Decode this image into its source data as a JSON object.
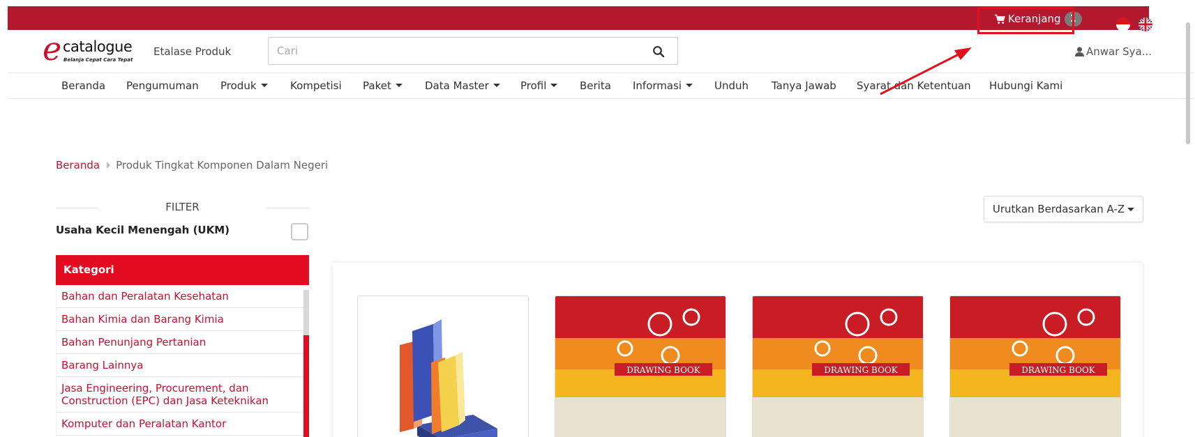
{
  "topbar": {
    "cart_label": "Keranjang",
    "cart_count": "1",
    "cart_icon": "shopping-cart-icon",
    "languages": [
      "id-flag",
      "en-flag"
    ]
  },
  "header": {
    "logo_letter": "e",
    "logo_word": "catalogue",
    "logo_tagline": "Belanja Cepat Cara Tepat",
    "etalase_label": "Etalase Produk",
    "search_placeholder": "Cari",
    "search_icon": "search-icon",
    "user_name": "Anwar Sya...",
    "user_icon": "user-icon"
  },
  "nav": {
    "items": [
      {
        "label": "Beranda",
        "dropdown": false
      },
      {
        "label": "Pengumuman",
        "dropdown": false
      },
      {
        "label": "Produk",
        "dropdown": true
      },
      {
        "label": "Kompetisi",
        "dropdown": false
      },
      {
        "label": "Paket",
        "dropdown": true
      },
      {
        "label": "Data Master",
        "dropdown": true
      },
      {
        "label": "Profil",
        "dropdown": true
      },
      {
        "label": "Berita",
        "dropdown": false
      },
      {
        "label": "Informasi",
        "dropdown": true
      },
      {
        "label": "Unduh",
        "dropdown": false
      },
      {
        "label": "Tanya Jawab",
        "dropdown": false
      },
      {
        "label": "Syarat dan Ketentuan",
        "dropdown": false
      },
      {
        "label": "Hubungi Kami",
        "dropdown": false
      }
    ]
  },
  "breadcrumb": {
    "home": "Beranda",
    "current": "Produk Tingkat Komponen Dalam Negeri"
  },
  "filter": {
    "title": "FILTER",
    "ukm_label": "Usaha Kecil Menengah (UKM)",
    "ukm_checked": false
  },
  "kategori": {
    "title": "Kategori",
    "items": [
      "Bahan dan Peralatan Kesehatan",
      "Bahan Kimia dan Barang Kimia",
      "Bahan Penunjang Pertanian",
      "Barang Lainnya",
      "Jasa Engineering, Procurement, dan Construction (EPC) dan Jasa Keteknikan",
      "Komputer dan Peralatan Kantor"
    ]
  },
  "sort": {
    "label": "Urutkan Berdasarkan A-Z"
  },
  "products": [
    {
      "image": "books-illustration"
    },
    {
      "image": "drawing-book-photo",
      "cover_text": "DRAWING BOOK"
    },
    {
      "image": "drawing-book-photo",
      "cover_text": "DRAWING BOOK"
    },
    {
      "image": "drawing-book-photo",
      "cover_text": "DRAWING BOOK"
    }
  ],
  "colors": {
    "brand_red": "#b3182e",
    "accent_red": "#e30b1f",
    "link_red": "#c8102e",
    "annotation_red": "#e3101e"
  }
}
